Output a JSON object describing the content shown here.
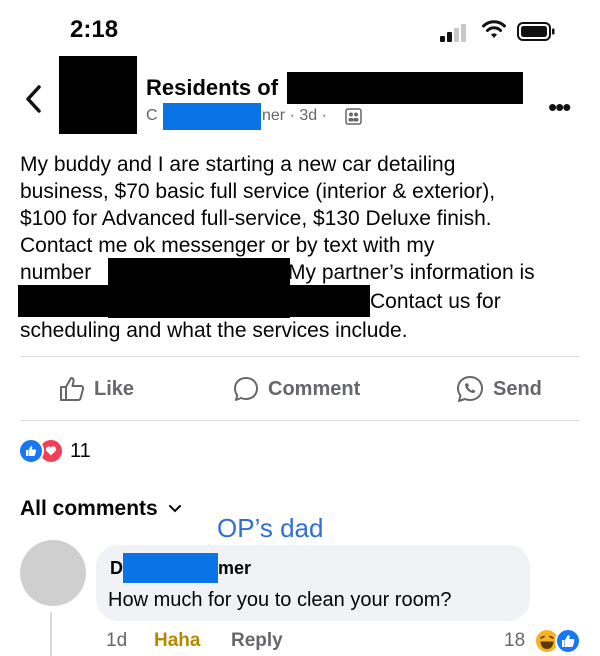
{
  "status_bar": {
    "time": "2:18"
  },
  "post": {
    "group_name": "Residents of",
    "author_start": "C",
    "author_end": "ner",
    "meta": "· 3d ·",
    "lines": [
      "My buddy and I are starting a new car detailing",
      "business, $70 basic full service (interior & exterior),",
      "$100 for Advanced full-service, $130 Deluxe finish.",
      "Contact me ok messenger or by text with my",
      "number",
      "My partner’s information is",
      "Contact us for",
      "scheduling and what the services include."
    ]
  },
  "actions": {
    "like": "Like",
    "comment": "Comment",
    "send": "Send"
  },
  "reactions": {
    "count": "11"
  },
  "comments": {
    "sort_label": "All comments",
    "annotation": "OP’s dad",
    "commenter_start": "D",
    "commenter_end": "mer",
    "text": "How much for you to clean your room?",
    "time": "1d",
    "reaction_label": "Haha",
    "reply_label": "Reply",
    "reaction_count": "18"
  },
  "colors": {
    "redact_blue": "#0a73e6",
    "like_blue": "#1877f2",
    "love_red": "#f33e58",
    "haha_yellow": "#f7b125",
    "annotation_blue": "#2f6fd8"
  },
  "icons": [
    "back-icon",
    "more-icon",
    "group-icon",
    "like-icon",
    "comment-icon",
    "send-icon",
    "chevron-down-icon"
  ]
}
